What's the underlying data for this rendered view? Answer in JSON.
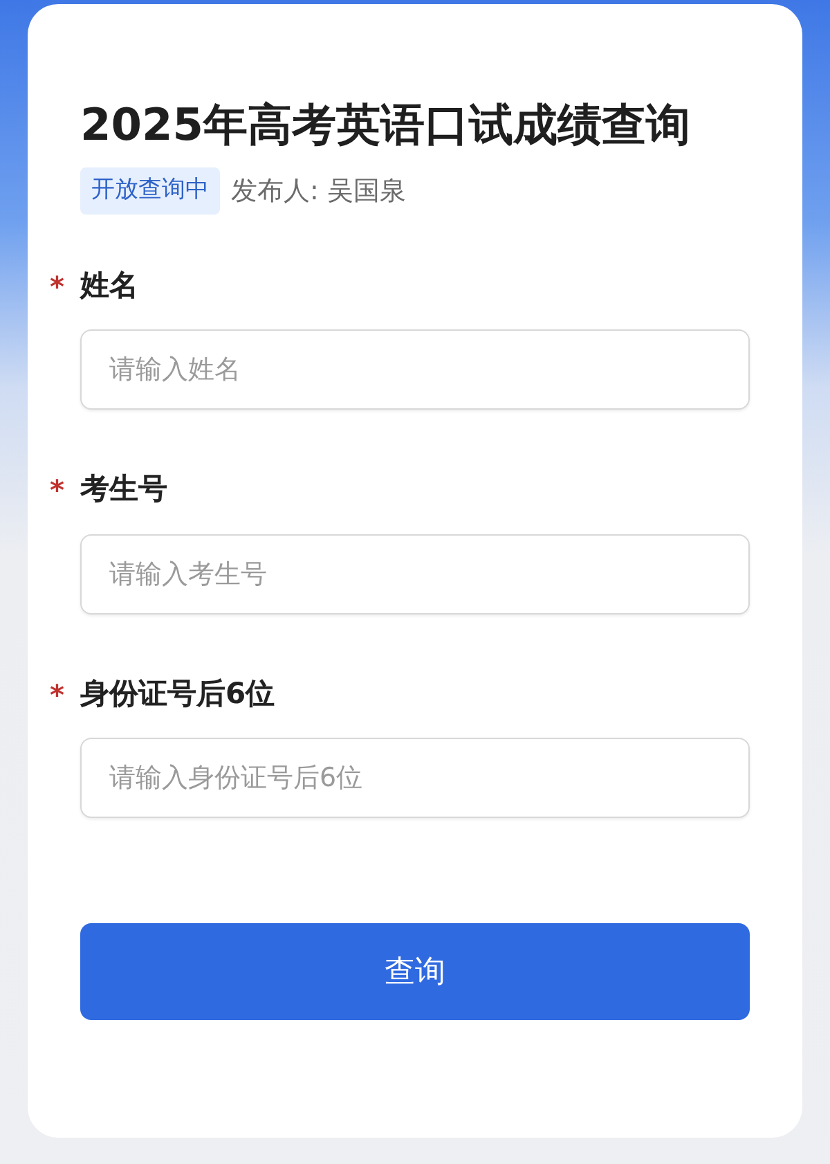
{
  "title": "2025年高考英语口试成绩查询",
  "status_badge": "开放查询中",
  "publisher": "发布人: 吴国泉",
  "fields": [
    {
      "required_mark": "*",
      "label": "姓名",
      "placeholder": "请输入姓名"
    },
    {
      "required_mark": "*",
      "label": "考生号",
      "placeholder": "请输入考生号"
    },
    {
      "required_mark": "*",
      "label": "身份证号后6位",
      "placeholder": "请输入身份证号后6位"
    }
  ],
  "submit_button": "查询"
}
